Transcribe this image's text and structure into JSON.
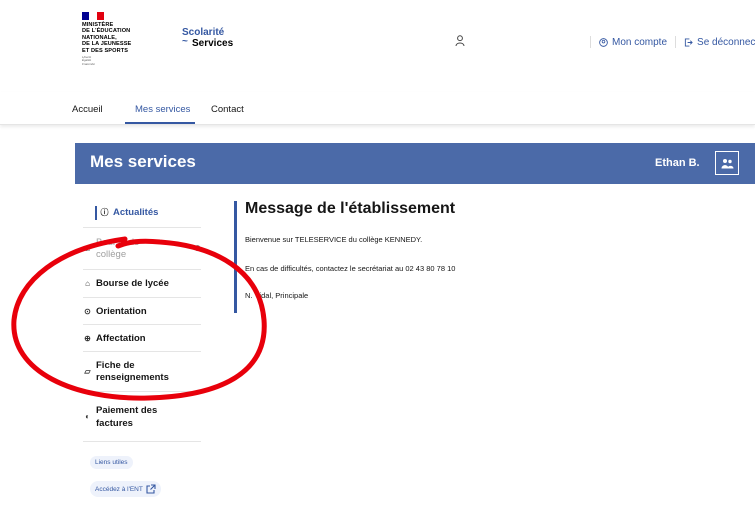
{
  "header": {
    "ministry_lines": [
      "MINISTÈRE",
      "DE L'ÉDUCATION",
      "NATIONALE,",
      "DE LA JEUNESSE",
      "ET DES SPORTS"
    ],
    "motto_lines": [
      "Liberté",
      "Égalité",
      "Fraternité"
    ],
    "brand_top": "Scolarité",
    "brand_bottom": "Services",
    "account_link": "Mon compte",
    "logout_link": "Se déconnecter"
  },
  "nav": {
    "items": [
      "Accueil",
      "Mes services",
      "Contact"
    ],
    "active": "Mes services"
  },
  "banner": {
    "title": "Mes services",
    "user_name": "Ethan B."
  },
  "sidebar": {
    "items": [
      {
        "label": "Actualités",
        "icon": "info-icon",
        "state": "active"
      },
      {
        "label_lines": [
          "Bourse de",
          "collège"
        ],
        "icon": "school-icon",
        "state": "disabled"
      },
      {
        "label": "Bourse de lycée",
        "icon": "school-icon",
        "state": "normal"
      },
      {
        "label": "Orientation",
        "icon": "compass-icon",
        "state": "normal"
      },
      {
        "label": "Affectation",
        "icon": "target-icon",
        "state": "normal"
      },
      {
        "label_lines": [
          "Fiche de",
          "renseignements"
        ],
        "icon": "document-icon",
        "state": "normal"
      },
      {
        "label_lines": [
          "Paiement des",
          "factures"
        ],
        "icon": "payment-icon",
        "state": "normal"
      }
    ],
    "useful_links": "Liens utiles",
    "ent_link": "Accédez à l'ENT"
  },
  "main": {
    "title": "Message de l'établissement",
    "lines": [
      "Bienvenue sur TELESERVICE du collège KENNEDY.",
      "En cas de difficultés, contactez le secrétariat au 02 43 80 78 10",
      "N. Vidal, Principale"
    ]
  },
  "colors": {
    "accent": "#3558a2",
    "banner": "#4b6aa8",
    "annotation": "#e8000b"
  }
}
